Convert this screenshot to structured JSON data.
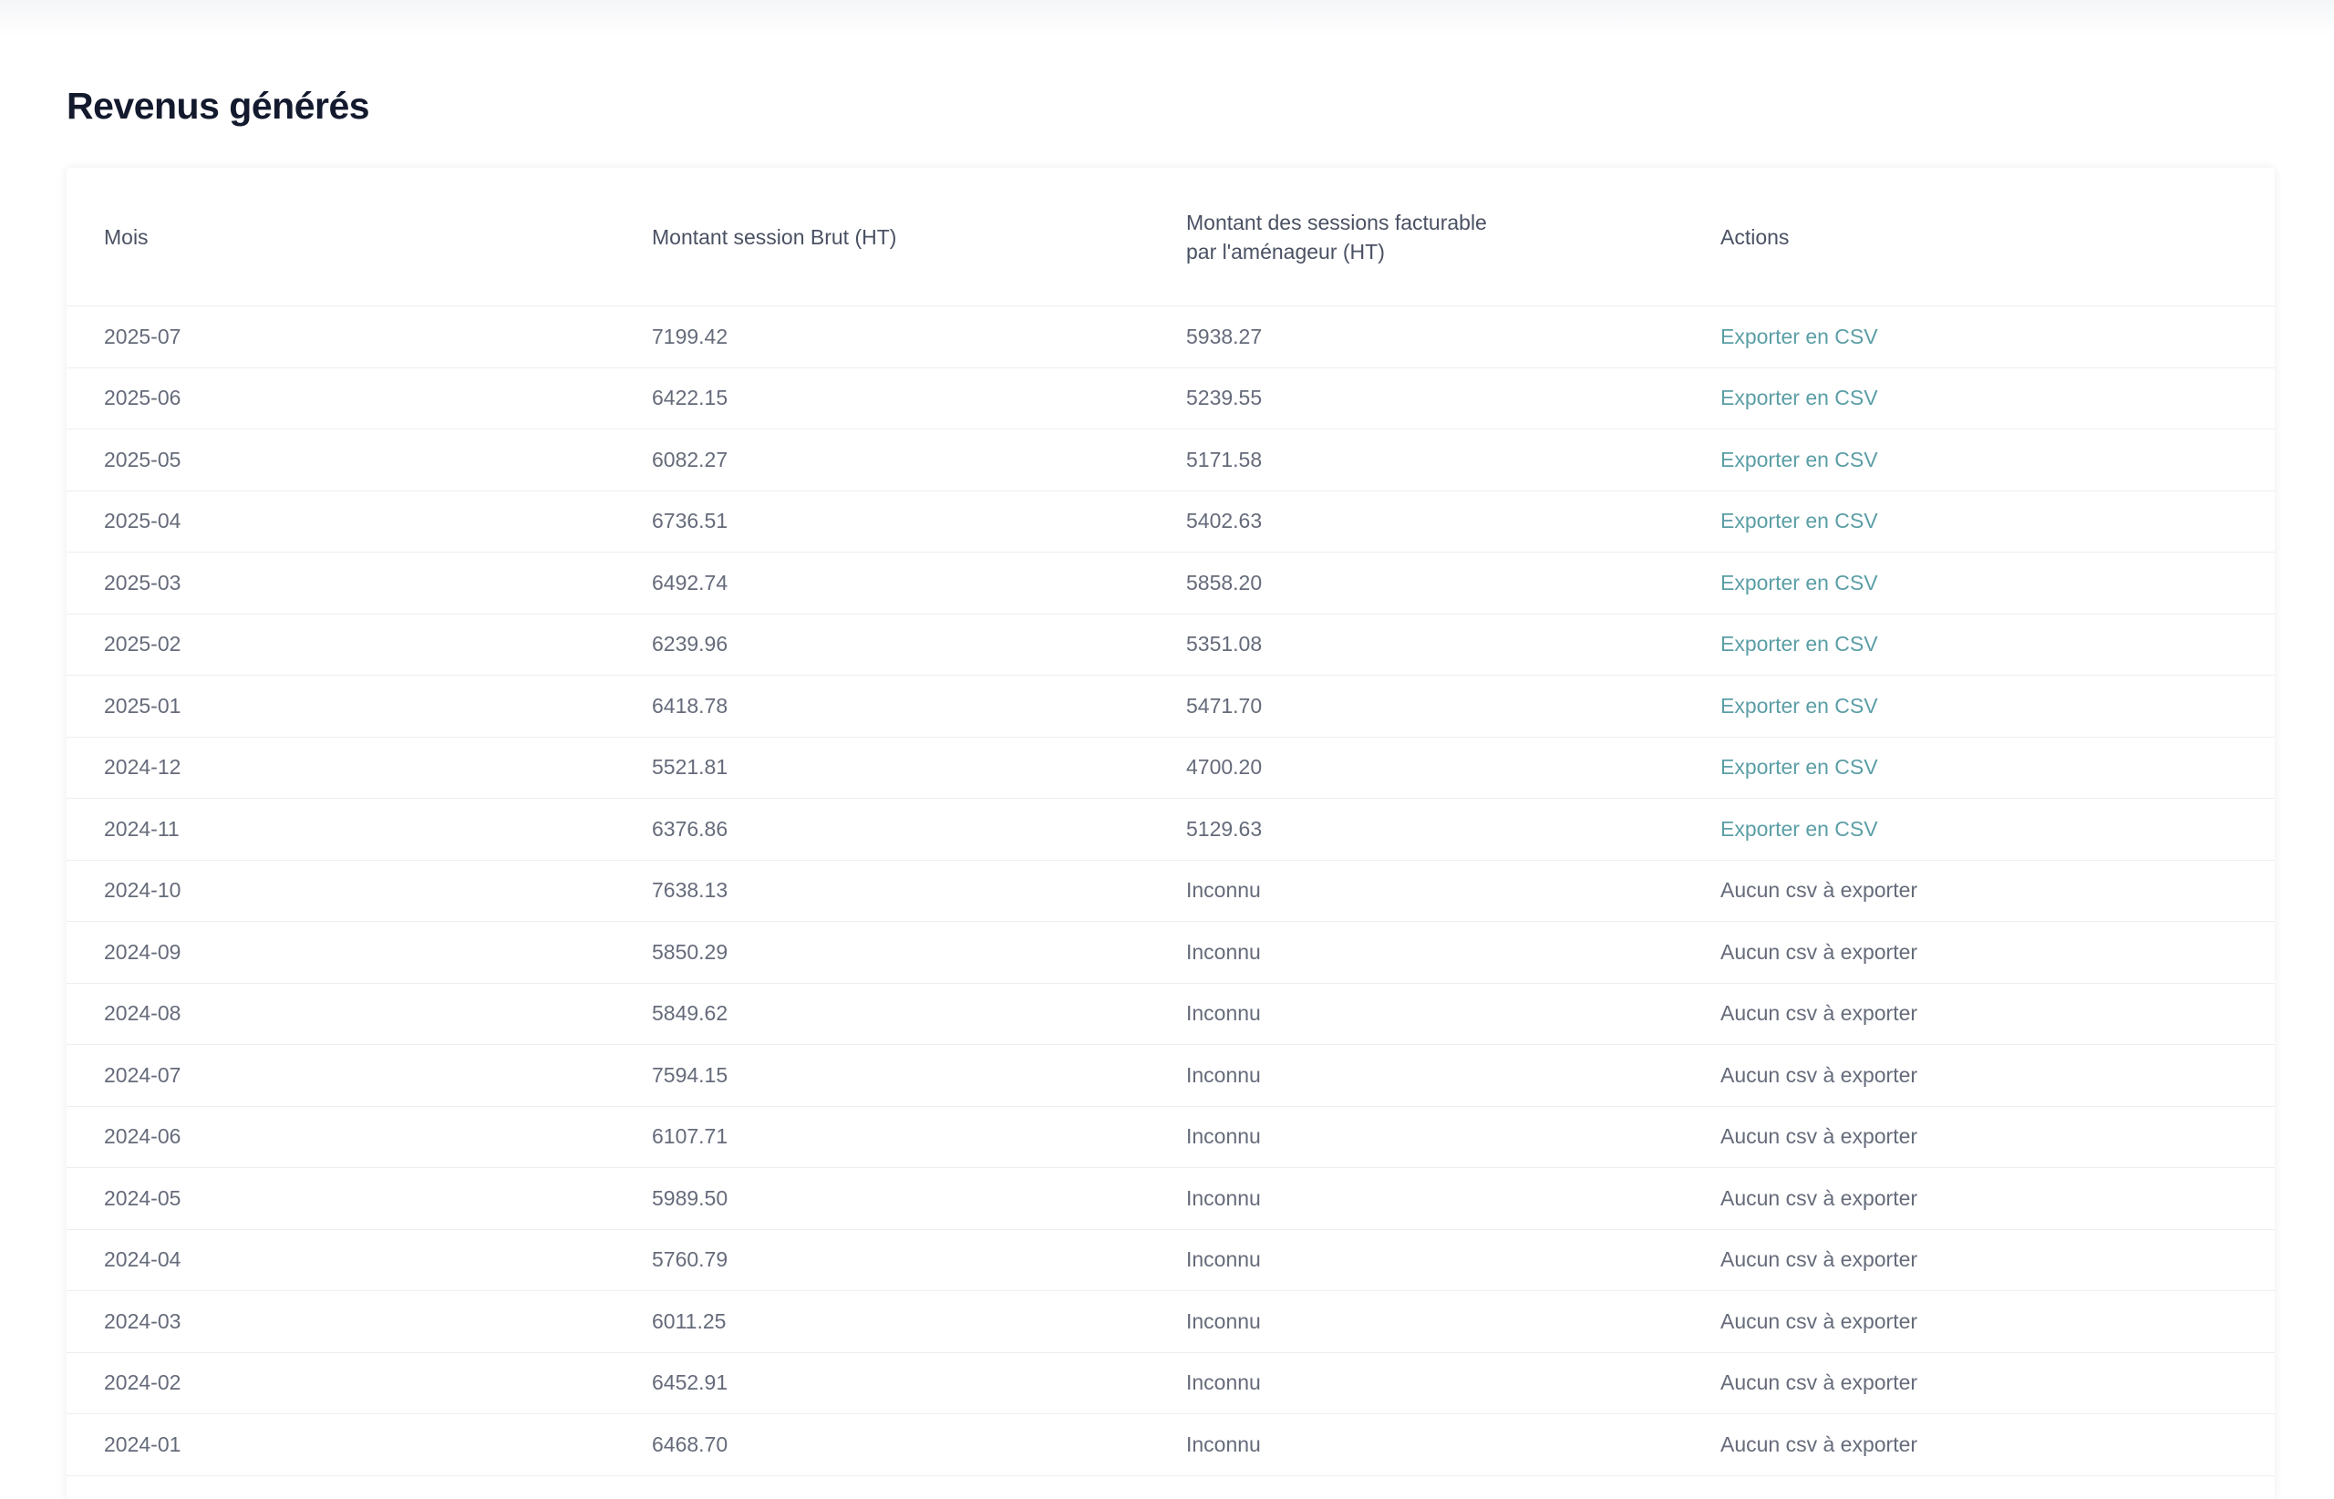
{
  "page": {
    "title": "Revenus générés"
  },
  "table": {
    "headers": {
      "month": "Mois",
      "gross": "Montant session Brut (HT)",
      "billable": "Montant des sessions facturable par l'aménageur (HT)",
      "actions": "Actions"
    },
    "rows": [
      {
        "month": "2025-07",
        "gross": "7199.42",
        "billable": "5938.27",
        "action": "Exporter en CSV",
        "exportable": true
      },
      {
        "month": "2025-06",
        "gross": "6422.15",
        "billable": "5239.55",
        "action": "Exporter en CSV",
        "exportable": true
      },
      {
        "month": "2025-05",
        "gross": "6082.27",
        "billable": "5171.58",
        "action": "Exporter en CSV",
        "exportable": true
      },
      {
        "month": "2025-04",
        "gross": "6736.51",
        "billable": "5402.63",
        "action": "Exporter en CSV",
        "exportable": true
      },
      {
        "month": "2025-03",
        "gross": "6492.74",
        "billable": "5858.20",
        "action": "Exporter en CSV",
        "exportable": true
      },
      {
        "month": "2025-02",
        "gross": "6239.96",
        "billable": "5351.08",
        "action": "Exporter en CSV",
        "exportable": true
      },
      {
        "month": "2025-01",
        "gross": "6418.78",
        "billable": "5471.70",
        "action": "Exporter en CSV",
        "exportable": true
      },
      {
        "month": "2024-12",
        "gross": "5521.81",
        "billable": "4700.20",
        "action": "Exporter en CSV",
        "exportable": true
      },
      {
        "month": "2024-11",
        "gross": "6376.86",
        "billable": "5129.63",
        "action": "Exporter en CSV",
        "exportable": true
      },
      {
        "month": "2024-10",
        "gross": "7638.13",
        "billable": "Inconnu",
        "action": "Aucun csv à exporter",
        "exportable": false
      },
      {
        "month": "2024-09",
        "gross": "5850.29",
        "billable": "Inconnu",
        "action": "Aucun csv à exporter",
        "exportable": false
      },
      {
        "month": "2024-08",
        "gross": "5849.62",
        "billable": "Inconnu",
        "action": "Aucun csv à exporter",
        "exportable": false
      },
      {
        "month": "2024-07",
        "gross": "7594.15",
        "billable": "Inconnu",
        "action": "Aucun csv à exporter",
        "exportable": false
      },
      {
        "month": "2024-06",
        "gross": "6107.71",
        "billable": "Inconnu",
        "action": "Aucun csv à exporter",
        "exportable": false
      },
      {
        "month": "2024-05",
        "gross": "5989.50",
        "billable": "Inconnu",
        "action": "Aucun csv à exporter",
        "exportable": false
      },
      {
        "month": "2024-04",
        "gross": "5760.79",
        "billable": "Inconnu",
        "action": "Aucun csv à exporter",
        "exportable": false
      },
      {
        "month": "2024-03",
        "gross": "6011.25",
        "billable": "Inconnu",
        "action": "Aucun csv à exporter",
        "exportable": false
      },
      {
        "month": "2024-02",
        "gross": "6452.91",
        "billable": "Inconnu",
        "action": "Aucun csv à exporter",
        "exportable": false
      },
      {
        "month": "2024-01",
        "gross": "6468.70",
        "billable": "Inconnu",
        "action": "Aucun csv à exporter",
        "exportable": false
      }
    ]
  },
  "colors": {
    "title": "#141a2e",
    "header_text": "#4a5163",
    "cell_text": "#656b7a",
    "link": "#5b9ea6",
    "divider": "#eceef2"
  }
}
